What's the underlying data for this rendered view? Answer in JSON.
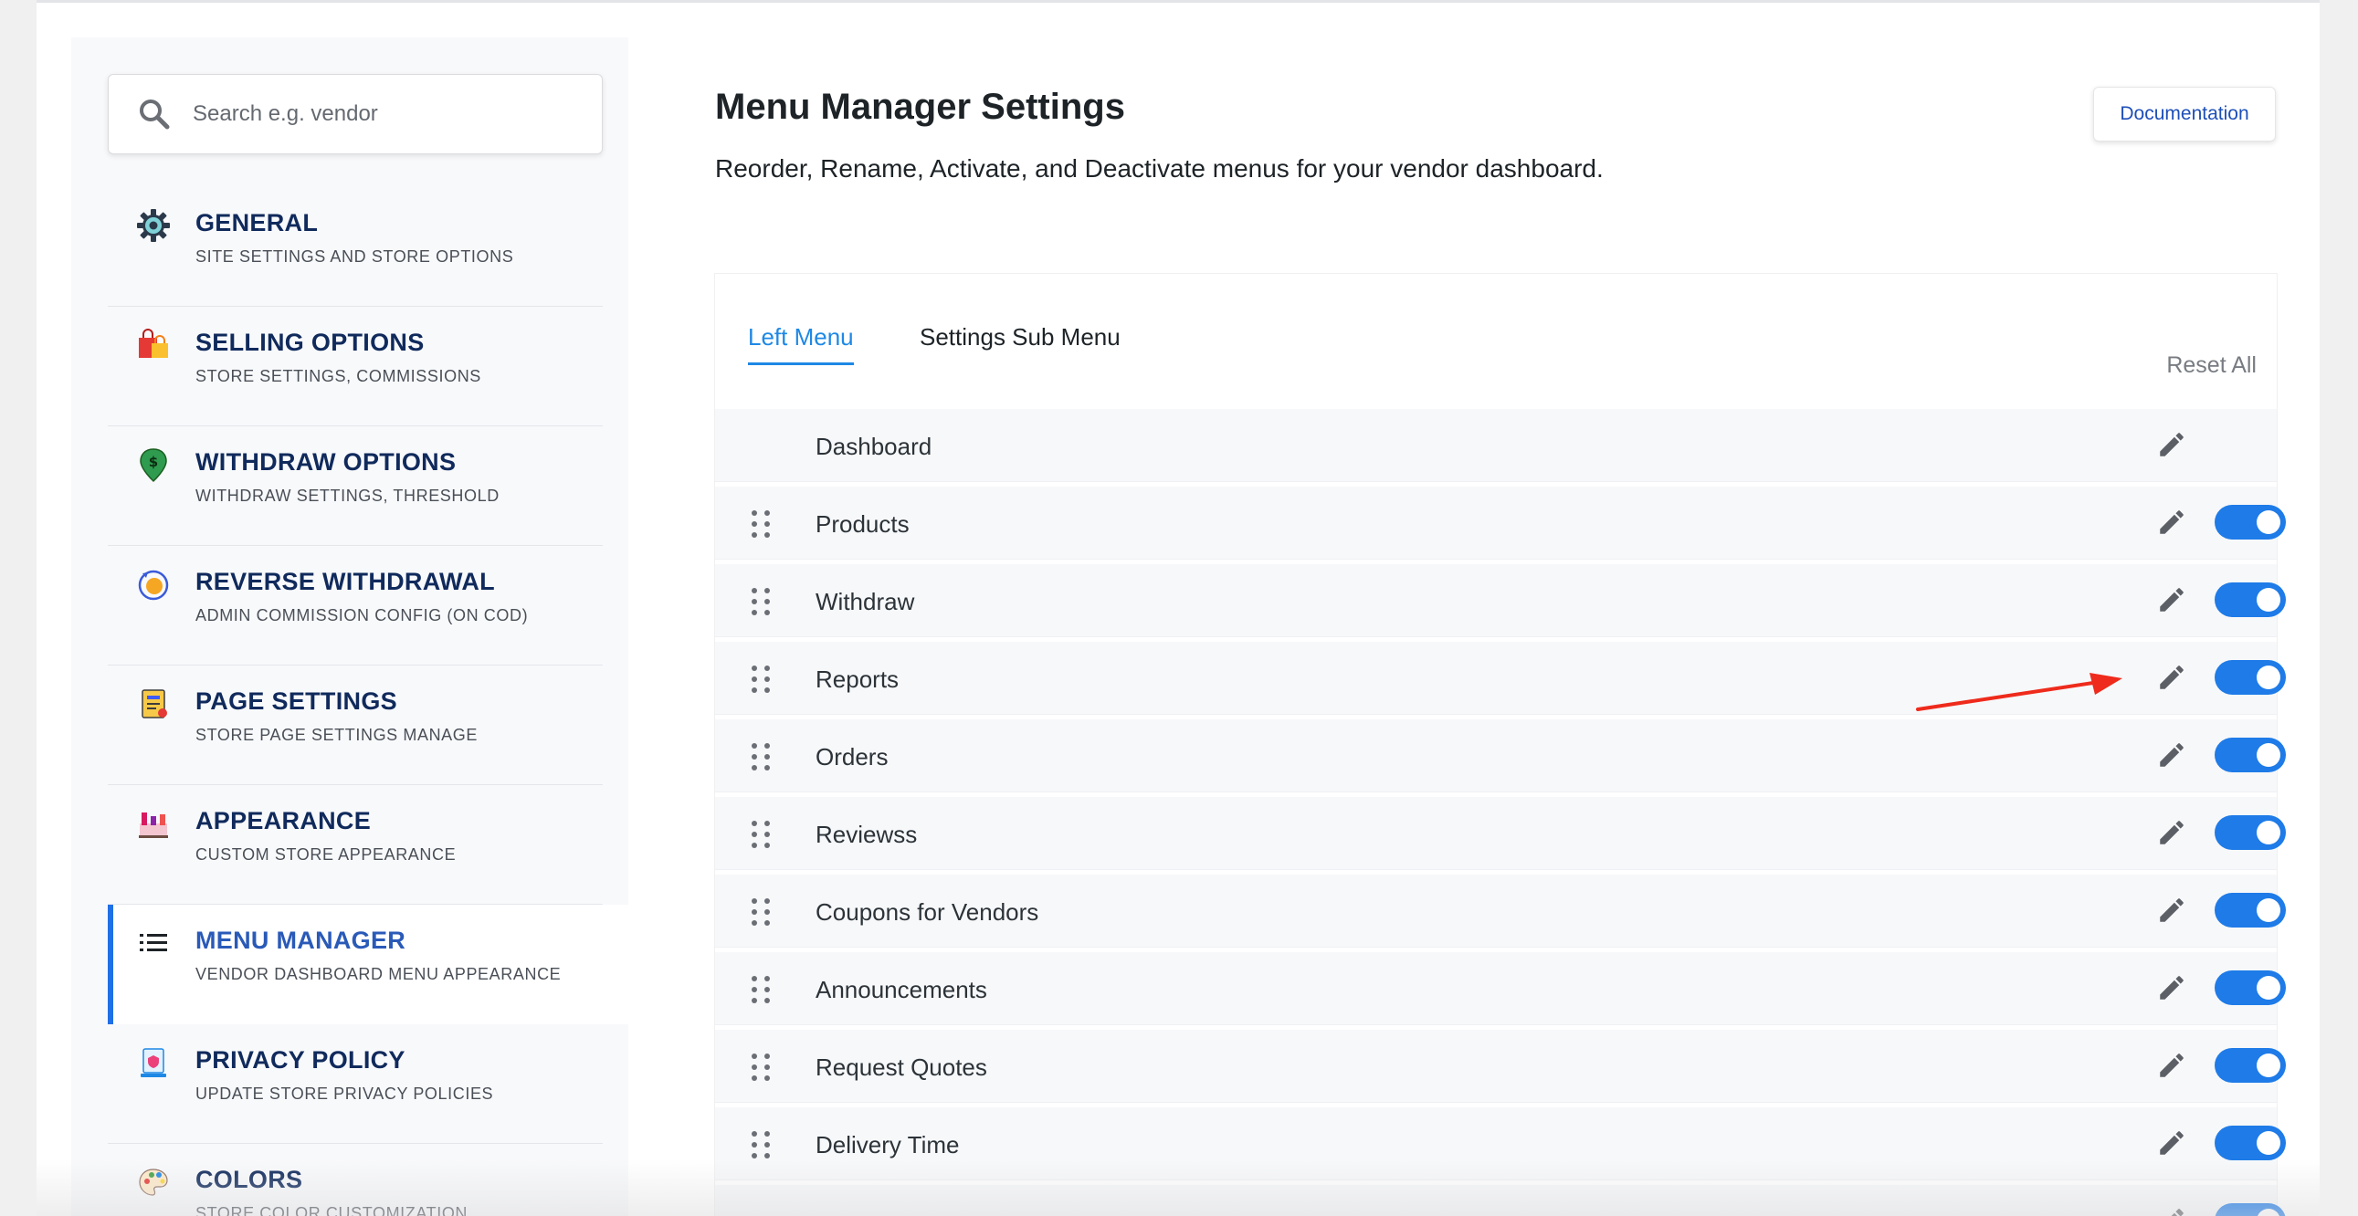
{
  "search": {
    "placeholder": "Search e.g. vendor"
  },
  "sidebar": {
    "items": [
      {
        "title": "GENERAL",
        "subtitle": "SITE SETTINGS AND STORE OPTIONS",
        "icon": "gear-icon"
      },
      {
        "title": "SELLING OPTIONS",
        "subtitle": "STORE SETTINGS, COMMISSIONS",
        "icon": "shopping-bags-icon"
      },
      {
        "title": "WITHDRAW OPTIONS",
        "subtitle": "WITHDRAW SETTINGS, THRESHOLD",
        "icon": "money-pin-icon"
      },
      {
        "title": "REVERSE WITHDRAWAL",
        "subtitle": "ADMIN COMMISSION CONFIG (ON COD)",
        "icon": "coin-cycle-icon"
      },
      {
        "title": "PAGE SETTINGS",
        "subtitle": "STORE PAGE SETTINGS MANAGE",
        "icon": "notebook-icon"
      },
      {
        "title": "APPEARANCE",
        "subtitle": "CUSTOM STORE APPEARANCE",
        "icon": "storefront-icon"
      },
      {
        "title": "MENU MANAGER",
        "subtitle": "VENDOR DASHBOARD MENU APPEARANCE",
        "icon": "list-icon",
        "active": true
      },
      {
        "title": "PRIVACY POLICY",
        "subtitle": "UPDATE STORE PRIVACY POLICIES",
        "icon": "privacy-icon"
      },
      {
        "title": "COLORS",
        "subtitle": "STORE COLOR CUSTOMIZATION",
        "icon": "palette-icon"
      }
    ]
  },
  "main": {
    "title": "Menu Manager Settings",
    "description": "Reorder, Rename, Activate, and Deactivate menus for your vendor dashboard.",
    "documentation_label": "Documentation",
    "tabs": [
      {
        "label": "Left Menu",
        "active": true
      },
      {
        "label": "Settings Sub Menu",
        "active": false
      }
    ],
    "reset_label": "Reset All",
    "menu_items": [
      {
        "label": "Dashboard",
        "draggable": false,
        "toggle": false
      },
      {
        "label": "Products",
        "draggable": true,
        "toggle": true,
        "enabled": true
      },
      {
        "label": "Withdraw",
        "draggable": true,
        "toggle": true,
        "enabled": true
      },
      {
        "label": "Reports",
        "draggable": true,
        "toggle": true,
        "enabled": true
      },
      {
        "label": "Orders",
        "draggable": true,
        "toggle": true,
        "enabled": true
      },
      {
        "label": "Reviewss",
        "draggable": true,
        "toggle": true,
        "enabled": true
      },
      {
        "label": "Coupons for Vendors",
        "draggable": true,
        "toggle": true,
        "enabled": true
      },
      {
        "label": "Announcements",
        "draggable": true,
        "toggle": true,
        "enabled": true
      },
      {
        "label": "Request Quotes",
        "draggable": true,
        "toggle": true,
        "enabled": true
      },
      {
        "label": "Delivery Time",
        "draggable": true,
        "toggle": true,
        "enabled": true
      },
      {
        "label": "",
        "draggable": true,
        "toggle": true,
        "enabled": true
      }
    ]
  },
  "colors": {
    "accent": "#1e7be8",
    "nav_title": "#102a5c",
    "annotation_arrow": "#ee2b1c"
  }
}
